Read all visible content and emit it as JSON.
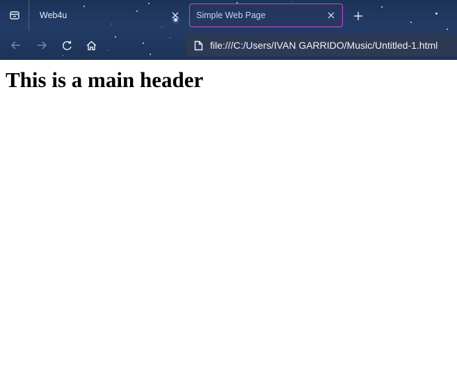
{
  "browser": {
    "tabs": [
      {
        "label": "Web4u",
        "active": false
      },
      {
        "label": "Simple Web Page",
        "active": true
      }
    ],
    "address_bar": {
      "url": "file:///C:/Users/IVAN GARRIDO/Music/Untitled-1.html"
    },
    "icons": {
      "tab_menu": "tab-list-icon",
      "close": "close-icon",
      "new_tab": "plus-icon",
      "back": "arrow-left-icon",
      "forward": "arrow-right-icon",
      "reload": "reload-icon",
      "home": "home-icon",
      "page": "file-icon"
    },
    "colors": {
      "chrome_background": "#233c66",
      "active_tab_border": "#c24bd0",
      "urlbar_background": "#303a54"
    }
  },
  "page": {
    "main_header": "This is a main header"
  }
}
